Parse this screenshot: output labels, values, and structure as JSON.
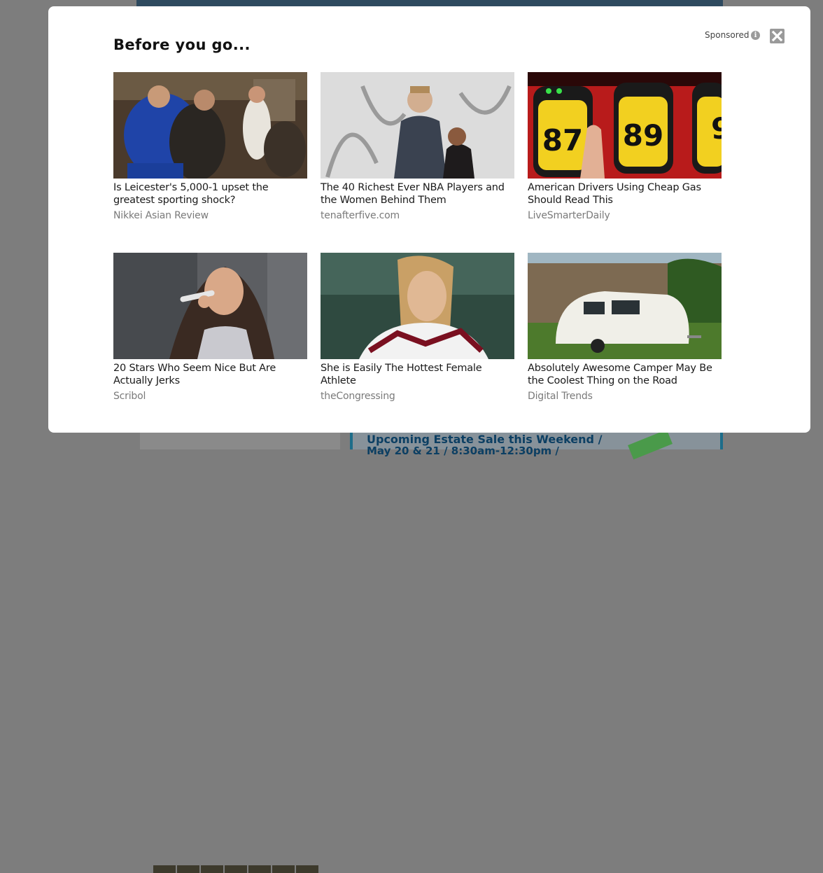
{
  "background": {
    "estate_title": "Upcoming Estate Sale this Weekend /",
    "estate_subtitle": "May 20 & 21 / 8:30am-12:30pm /"
  },
  "modal": {
    "title": "Before you go...",
    "sponsored_label": "Sponsored",
    "info_glyph": "i",
    "close_icon": "close-icon"
  },
  "cards": [
    {
      "title": "Is Leicester's 5,000-1 upset the greatest sporting shock?",
      "source": "Nikkei Asian Review",
      "image": "fans-celebrating-photo"
    },
    {
      "title": "The 40 Richest Ever NBA Players and the Women Behind Them",
      "source": "tenafterfive.com",
      "image": "couple-red-carpet-photo"
    },
    {
      "title": "American Drivers Using Cheap Gas Should Read This",
      "source": "LiveSmarterDaily",
      "image": "gas-pump-buttons-photo"
    },
    {
      "title": "20 Stars Who Seem Nice But Are Actually Jerks",
      "source": "Scribol",
      "image": "singer-microphone-photo"
    },
    {
      "title": "She is Easily The Hottest Female Athlete",
      "source": "theCongressing",
      "image": "rugby-athlete-photo"
    },
    {
      "title": "Absolutely Awesome Camper May Be the Coolest Thing on the Road",
      "source": "Digital Trends",
      "image": "white-camper-photo"
    }
  ],
  "colors": {
    "overlay": "#7d7d7d",
    "modal_bg": "#ffffff",
    "title_text": "#111111",
    "source_text": "#7a7a7a",
    "close_button": "#9a9a9a"
  }
}
